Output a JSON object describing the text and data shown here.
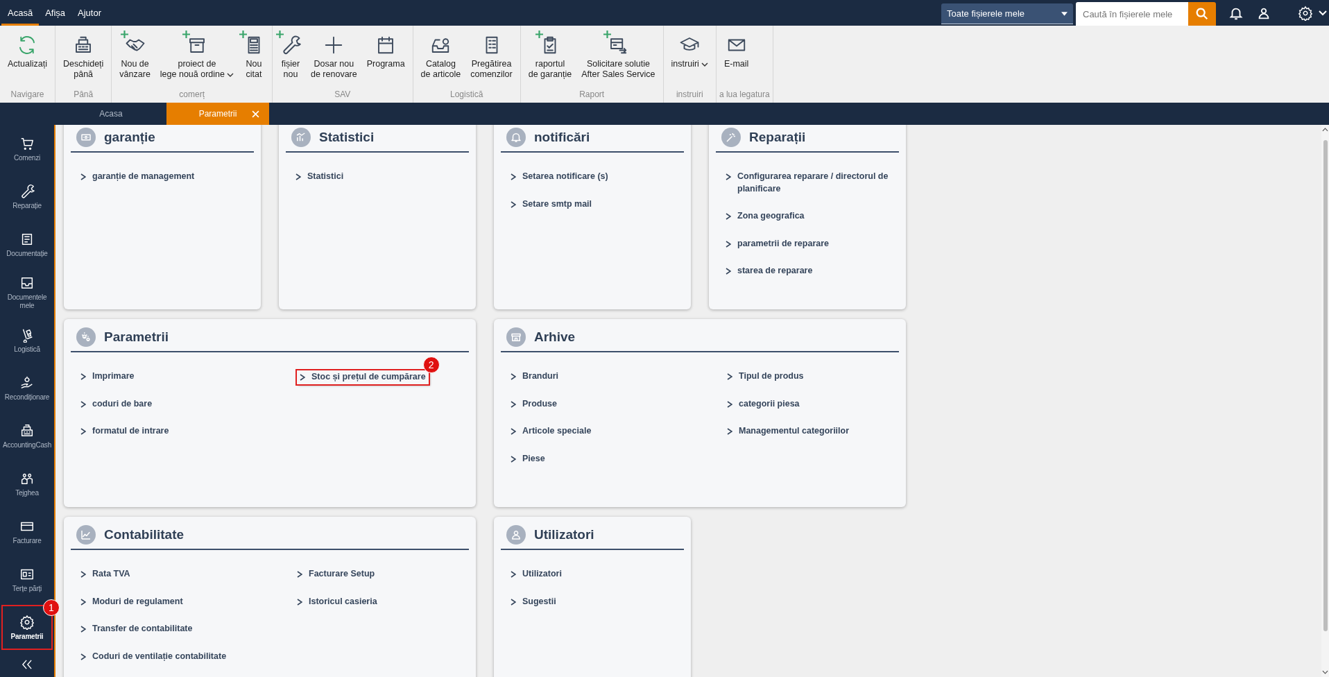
{
  "menu": [
    {
      "label": "Acasă",
      "selected": true
    },
    {
      "label": "Afișa",
      "selected": false
    },
    {
      "label": "Ajutor",
      "selected": false
    }
  ],
  "top_bar": {
    "scope_select": "Toate fișierele mele",
    "search": {
      "placeholder": "Caută în fișierele mele"
    }
  },
  "ribbon": [
    {
      "group": "Navigare",
      "buttons": [
        {
          "label": "Actualizați",
          "plus": false,
          "dropdown": false
        }
      ]
    },
    {
      "group": "Până",
      "buttons": [
        {
          "label": "Deschideți\npână",
          "plus": false,
          "dropdown": false
        }
      ]
    },
    {
      "group": "comerț",
      "buttons": [
        {
          "label": "Nou de\nvânzare",
          "plus": true,
          "dropdown": false
        },
        {
          "label": "proiect de\nlege nouă ordine",
          "plus": true,
          "dropdown": true
        },
        {
          "label": "Nou\ncitat",
          "plus": true,
          "dropdown": false
        }
      ]
    },
    {
      "group": "SAV",
      "buttons": [
        {
          "label": "fișier\nnou",
          "plus": true,
          "dropdown": false
        },
        {
          "label": "Dosar nou\nde renovare",
          "plus": false,
          "dropdown": false
        },
        {
          "label": "Programa",
          "plus": false,
          "dropdown": false
        }
      ]
    },
    {
      "group": "Logistică",
      "buttons": [
        {
          "label": "Catalog\nde articole",
          "plus": false,
          "dropdown": false
        },
        {
          "label": "Pregătirea\ncomenzilor",
          "plus": false,
          "dropdown": false
        }
      ]
    },
    {
      "group": "Raport",
      "buttons": [
        {
          "label": "raportul\nde garanție",
          "plus": true,
          "dropdown": false
        },
        {
          "label": "Solicitare solutie\nAfter Sales Service",
          "plus": true,
          "dropdown": false
        }
      ]
    },
    {
      "group": "instruiri",
      "buttons": [
        {
          "label": "instruiri",
          "plus": false,
          "dropdown": true
        }
      ]
    },
    {
      "group": "a lua legatura",
      "buttons": [
        {
          "label": "E-mail",
          "plus": false,
          "dropdown": false
        }
      ]
    }
  ],
  "tabs": [
    {
      "label": "Acasa",
      "selected": false,
      "closable": false
    },
    {
      "label": "Parametrii",
      "selected": true,
      "closable": true
    }
  ],
  "sidebar": {
    "items": [
      {
        "label": "Comenzi",
        "selected": false
      },
      {
        "label": "Reparație",
        "selected": false
      },
      {
        "label": "Documentație",
        "selected": false
      },
      {
        "label": "Documentele mele",
        "selected": false
      },
      {
        "label": "Logistică",
        "selected": false
      },
      {
        "label": "Recondiționare",
        "selected": false
      },
      {
        "label": "AccountingCash",
        "selected": false
      },
      {
        "label": "Tejghea",
        "selected": false
      },
      {
        "label": "Facturare",
        "selected": false
      },
      {
        "label": "Terțe părți",
        "selected": false
      },
      {
        "label": "Parametrii",
        "selected": true,
        "callout": "1"
      }
    ]
  },
  "cards": [
    {
      "title": "garanție",
      "columns": [
        [
          {
            "label": "garanție de management"
          }
        ]
      ]
    },
    {
      "title": "Statistici",
      "columns": [
        [
          {
            "label": "Statistici"
          }
        ]
      ]
    },
    {
      "title": "notificări",
      "columns": [
        [
          {
            "label": "Setarea notificare (s)"
          },
          {
            "label": "Setare smtp mail"
          }
        ]
      ]
    },
    {
      "title": "Reparații",
      "columns": [
        [
          {
            "label": "Configurarea reparare / directorul de planificare"
          },
          {
            "label": "Zona geografica"
          },
          {
            "label": "parametrii de reparare"
          },
          {
            "label": "starea de reparare"
          }
        ]
      ]
    },
    {
      "title": "Parametrii",
      "columns": [
        [
          {
            "label": "Imprimare"
          },
          {
            "label": "coduri de bare"
          },
          {
            "label": "formatul de intrare"
          }
        ],
        [
          {
            "label": "Stoc și prețul de cumpărare",
            "callout": "2"
          }
        ]
      ]
    },
    {
      "title": "Arhive",
      "columns": [
        [
          {
            "label": "Branduri"
          },
          {
            "label": "Produse"
          },
          {
            "label": "Articole speciale"
          },
          {
            "label": "Piese"
          }
        ],
        [
          {
            "label": "Tipul de produs"
          },
          {
            "label": "categorii piesa"
          },
          {
            "label": "Managementul categoriilor"
          }
        ]
      ]
    },
    {
      "title": "Contabilitate",
      "columns": [
        [
          {
            "label": "Rata TVA"
          },
          {
            "label": "Moduri de regulament"
          },
          {
            "label": "Transfer de contabilitate"
          },
          {
            "label": "Coduri de ventilație contabilitate"
          }
        ],
        [
          {
            "label": "Facturare Setup"
          },
          {
            "label": "Istoricul casieria"
          }
        ]
      ]
    },
    {
      "title": "Utilizatori",
      "columns": [
        [
          {
            "label": "Utilizatori"
          },
          {
            "label": "Sugestii"
          }
        ]
      ]
    }
  ]
}
